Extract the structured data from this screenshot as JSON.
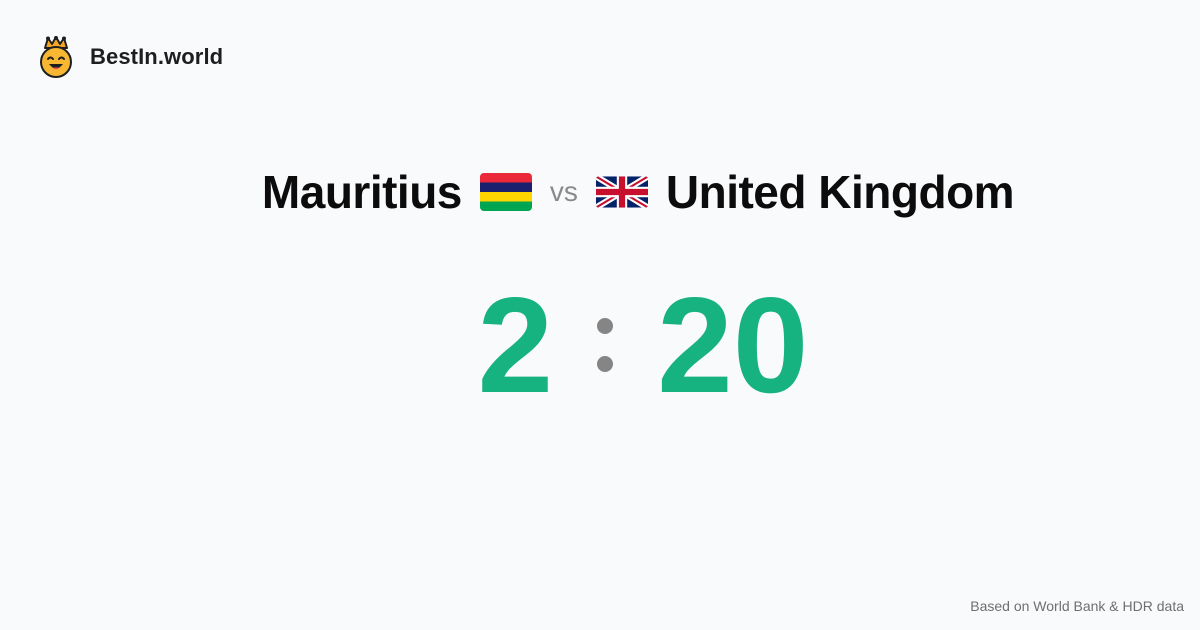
{
  "brand": {
    "name": "BestIn.world",
    "logo_icon": "crown-smiley-icon"
  },
  "matchup": {
    "left_country": "Mauritius",
    "left_flag_icon": "mauritius-flag-icon",
    "vs_label": "vs",
    "right_country": "United Kingdom",
    "right_flag_icon": "uk-flag-icon"
  },
  "score": {
    "left": "2",
    "right": "20",
    "color": "#16b27f"
  },
  "footer": {
    "source_note": "Based on World Bank & HDR data"
  }
}
